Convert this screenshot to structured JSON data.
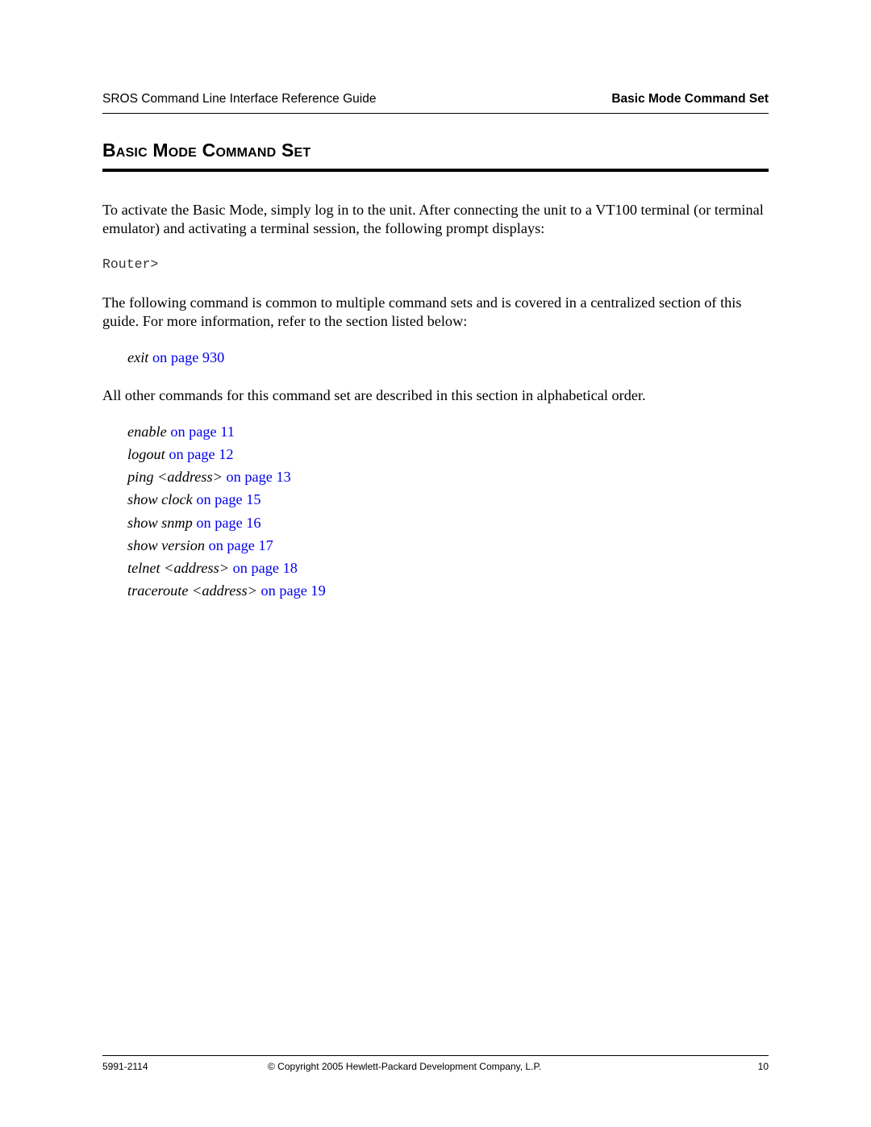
{
  "header": {
    "guide_title": "SROS Command Line Interface Reference Guide",
    "section_name": "Basic Mode Command Set"
  },
  "section": {
    "title": "Basic Mode Command Set"
  },
  "paragraphs": {
    "intro": "To activate the Basic Mode, simply log in to the unit. After connecting the unit to a VT100 terminal (or terminal emulator) and activating a terminal session, the following prompt displays:",
    "prompt": "Router>",
    "common": "The following command is common to multiple command sets and is covered in a centralized section of this guide. For more information, refer to the section listed below:",
    "alphabetical": "All other commands for this command set are described in this section in alphabetical order."
  },
  "common_commands": [
    {
      "command": "exit",
      "link": "on page 930"
    }
  ],
  "commands": [
    {
      "command": "enable",
      "link": "on page 11"
    },
    {
      "command": "logout",
      "link": "on page 12"
    },
    {
      "command": "ping <address>",
      "link": "on page 13"
    },
    {
      "command": "show clock",
      "link": "on page 15"
    },
    {
      "command": "show snmp",
      "link": "on page 16"
    },
    {
      "command": "show version",
      "link": "on page 17"
    },
    {
      "command": "telnet <address>",
      "link": "on page 18"
    },
    {
      "command": "traceroute <address>",
      "link": "on page 19"
    }
  ],
  "footer": {
    "doc_number": "5991-2114",
    "copyright": "© Copyright 2005 Hewlett-Packard Development Company, L.P.",
    "page_number": "10"
  },
  "colors": {
    "link": "#0000ee",
    "text": "#000000"
  }
}
